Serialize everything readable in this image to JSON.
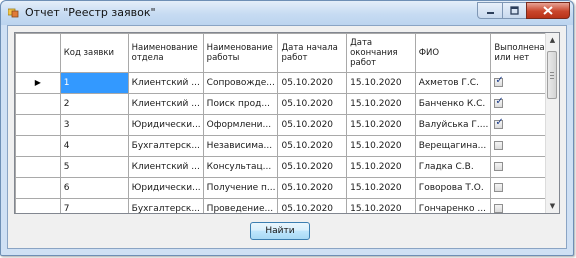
{
  "window": {
    "title": "Отчет \"Реестр заявок\"",
    "controls": {
      "minimize": "–",
      "maximize": "□",
      "close": "✕"
    }
  },
  "grid": {
    "columns": [
      "Код заявки",
      "Наименование отдела",
      "Наименование работы",
      "Дата начала работ",
      "Дата окончания работ",
      "ФИО",
      "Выполнена или нет"
    ],
    "current_row_marker": "▶",
    "rows": [
      {
        "id": "1",
        "dept": "Клиентский ...",
        "work": "Сопровожде...",
        "start": "05.10.2020",
        "end": "15.10.2020",
        "fio": "Ахметов Г.С.",
        "done": true
      },
      {
        "id": "2",
        "dept": "Клиентский ...",
        "work": "Поиск прод...",
        "start": "05.10.2020",
        "end": "15.10.2020",
        "fio": "Банченко К.С.",
        "done": true
      },
      {
        "id": "3",
        "dept": "Юридически...",
        "work": "Оформлени...",
        "start": "05.10.2020",
        "end": "15.10.2020",
        "fio": "Валуйська Г....",
        "done": true
      },
      {
        "id": "4",
        "dept": "Бухгалтерск...",
        "work": "Независима...",
        "start": "05.10.2020",
        "end": "15.10.2020",
        "fio": "Верещагина...",
        "done": false
      },
      {
        "id": "5",
        "dept": "Клиентский ...",
        "work": "Консультац...",
        "start": "05.10.2020",
        "end": "15.10.2020",
        "fio": "Гладка С.В.",
        "done": false
      },
      {
        "id": "6",
        "dept": "Юридически...",
        "work": "Получение п...",
        "start": "05.10.2020",
        "end": "15.10.2020",
        "fio": "Говорова Т.О.",
        "done": false
      },
      {
        "id": "7",
        "dept": "Бухгалтерск...",
        "work": "Проведение...",
        "start": "05.10.2020",
        "end": "15.10.2020",
        "fio": "Гончаренко ...",
        "done": false
      }
    ]
  },
  "scrollbar": {
    "up": "▲",
    "down": "▼"
  },
  "find_button": {
    "label": "Найти"
  },
  "colors": {
    "selection": "#3399ff",
    "titlebar": "#c6dbf2",
    "close": "#c9462c"
  }
}
